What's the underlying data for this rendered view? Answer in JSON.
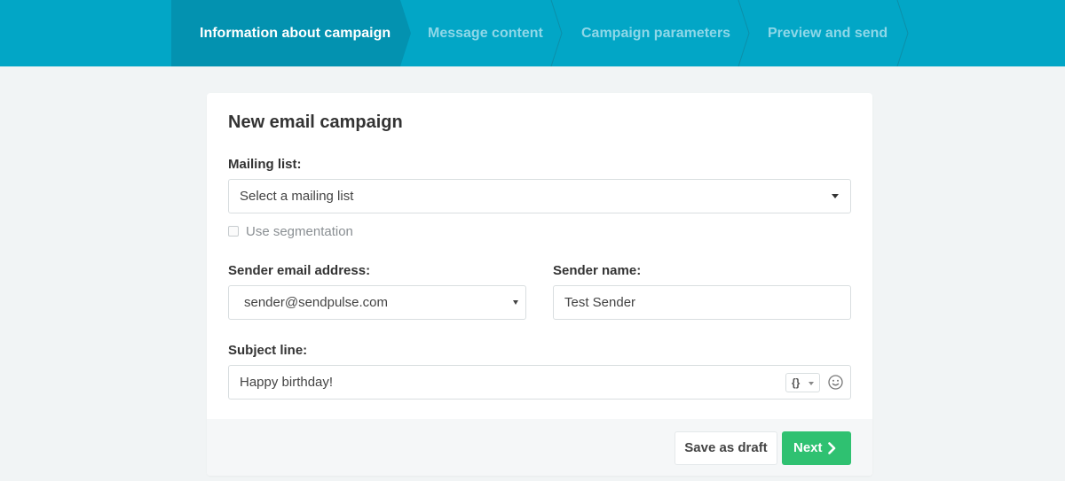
{
  "stepper": {
    "steps": [
      {
        "label": "Information about campaign",
        "active": true
      },
      {
        "label": "Message content",
        "active": false
      },
      {
        "label": "Campaign parameters",
        "active": false
      },
      {
        "label": "Preview and send",
        "active": false
      }
    ]
  },
  "form": {
    "title": "New email campaign",
    "mailing_list": {
      "label": "Mailing list:",
      "value": "Select a mailing list"
    },
    "segmentation": {
      "label": "Use segmentation",
      "checked": false
    },
    "sender_email": {
      "label": "Sender email address:",
      "value": "sender@sendpulse.com"
    },
    "sender_name": {
      "label": "Sender name:",
      "value": "Test Sender"
    },
    "subject": {
      "label": "Subject line:",
      "value": "Happy birthday!",
      "variables_icon": "{}"
    }
  },
  "footer": {
    "save_draft_label": "Save as draft",
    "next_label": "Next"
  },
  "colors": {
    "header_bg": "#02a6c6",
    "active_step_bg": "#0392b0",
    "primary_button": "#2fc171"
  }
}
